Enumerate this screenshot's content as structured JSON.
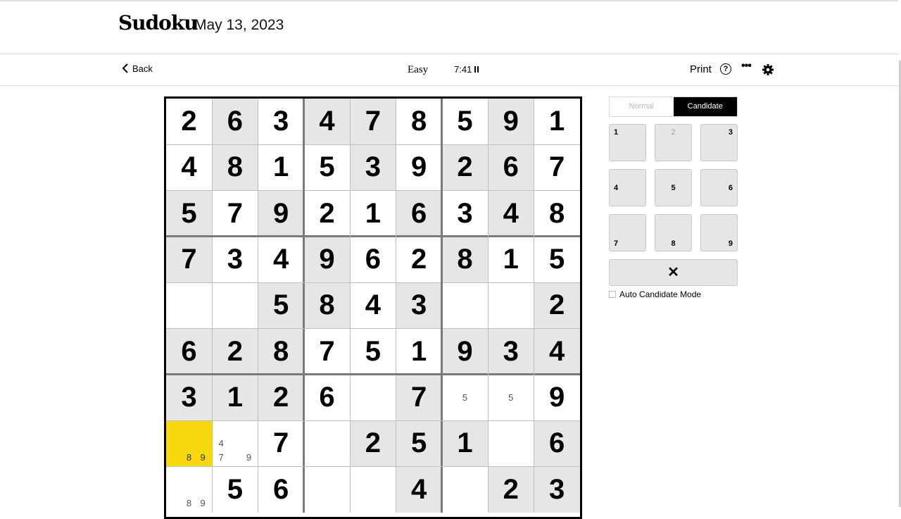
{
  "header": {
    "logo": "Sudoku",
    "date": "May 13, 2023"
  },
  "toolbar": {
    "back_label": "Back",
    "difficulty": "Easy",
    "timer": "7:41",
    "print_label": "Print",
    "help_glyph": "?",
    "more_glyph": "•••"
  },
  "colors": {
    "shaded": "#e6e6e6",
    "selected": "#f8d90f",
    "white": "#ffffff"
  },
  "grid": [
    [
      2,
      6,
      3,
      4,
      7,
      8,
      5,
      9,
      1
    ],
    [
      4,
      8,
      1,
      5,
      3,
      9,
      2,
      6,
      7
    ],
    [
      5,
      7,
      9,
      2,
      1,
      6,
      3,
      4,
      8
    ],
    [
      7,
      3,
      4,
      9,
      6,
      2,
      8,
      1,
      5
    ],
    [
      0,
      0,
      5,
      8,
      4,
      3,
      0,
      0,
      2
    ],
    [
      6,
      2,
      8,
      7,
      5,
      1,
      9,
      3,
      4
    ],
    [
      3,
      1,
      2,
      6,
      0,
      7,
      0,
      0,
      9
    ],
    [
      0,
      0,
      7,
      0,
      2,
      5,
      1,
      0,
      6
    ],
    [
      0,
      5,
      6,
      0,
      0,
      4,
      0,
      2,
      3
    ]
  ],
  "shading": [
    [
      0,
      1,
      0,
      1,
      1,
      0,
      0,
      1,
      0
    ],
    [
      0,
      1,
      0,
      0,
      1,
      0,
      1,
      1,
      0
    ],
    [
      1,
      0,
      1,
      0,
      0,
      1,
      0,
      1,
      0
    ],
    [
      1,
      0,
      0,
      1,
      0,
      0,
      1,
      0,
      0
    ],
    [
      0,
      0,
      1,
      1,
      0,
      1,
      0,
      0,
      1
    ],
    [
      1,
      1,
      1,
      0,
      0,
      0,
      1,
      1,
      1
    ],
    [
      1,
      1,
      1,
      0,
      0,
      1,
      0,
      0,
      0
    ],
    [
      2,
      0,
      0,
      0,
      1,
      1,
      1,
      0,
      1
    ],
    [
      0,
      0,
      0,
      0,
      0,
      1,
      0,
      1,
      1
    ]
  ],
  "candidates": [
    {
      "row": 6,
      "col": 6,
      "digits": [
        5
      ]
    },
    {
      "row": 6,
      "col": 7,
      "digits": [
        5
      ]
    },
    {
      "row": 7,
      "col": 0,
      "digits": [
        8,
        9
      ]
    },
    {
      "row": 7,
      "col": 1,
      "digits": [
        4,
        7,
        9
      ]
    },
    {
      "row": 8,
      "col": 0,
      "digits": [
        8,
        9
      ]
    }
  ],
  "mode": {
    "normal_label": "Normal",
    "candidate_label": "Candidate",
    "active": "candidate"
  },
  "keypad": [
    {
      "label": "1",
      "pos": "top-left",
      "dim": false
    },
    {
      "label": "2",
      "pos": "top-center",
      "dim": true
    },
    {
      "label": "3",
      "pos": "top-right",
      "dim": false
    },
    {
      "label": "4",
      "pos": "middle-left",
      "dim": false
    },
    {
      "label": "5",
      "pos": "middle-center",
      "dim": false
    },
    {
      "label": "6",
      "pos": "middle-right",
      "dim": false
    },
    {
      "label": "7",
      "pos": "bottom-left",
      "dim": false
    },
    {
      "label": "8",
      "pos": "bottom-center",
      "dim": false
    },
    {
      "label": "9",
      "pos": "bottom-right",
      "dim": false
    }
  ],
  "erase_glyph": "✕",
  "auto_candidate": {
    "label": "Auto Candidate Mode",
    "checked": false
  },
  "icons": {
    "back": "chevron-left-icon",
    "pause": "pause-icon",
    "help": "help-icon",
    "more": "more-icon",
    "settings": "gear-icon"
  }
}
